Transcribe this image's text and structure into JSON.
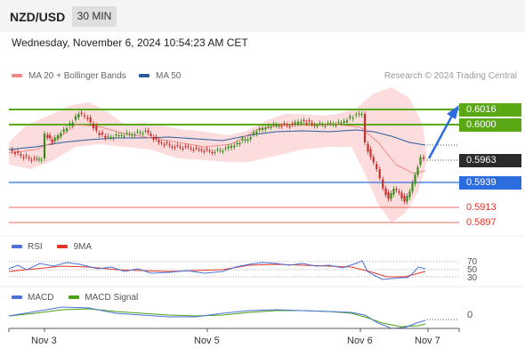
{
  "header": {
    "symbol": "NZD/USD",
    "timeframe": "30 MIN"
  },
  "datetime": "Wednesday, November 6, 2024 10:54:23 AM CET",
  "legend": {
    "ma20": "MA 20 + Bollinger Bands",
    "ma50": "MA 50",
    "credit": "Research © 2024 Trading Central"
  },
  "colors": {
    "ma20": "#f08a8a",
    "ma50": "#2a5d9c",
    "band": "#fbd6d6",
    "up": "#3a8a1c",
    "down": "#c9302c",
    "resistance": "#5aa813",
    "pivot": "#2b6cde",
    "support": "#e0362a",
    "rsi": "#4a72d8",
    "rsi_ma": "#e0362a",
    "macd": "#4a72d8",
    "macd_signal": "#4aa013"
  },
  "levels": {
    "r2": "0.6016",
    "r1": "0.6000",
    "last": "0.5963",
    "pivot": "0.5939",
    "s1": "0.5913",
    "s2": "0.5897"
  },
  "rsi": {
    "label": "RSI",
    "ma_label": "9MA",
    "levels": [
      "70",
      "50",
      "30"
    ]
  },
  "macd": {
    "label": "MACD",
    "signal_label": "MACD Signal",
    "zero": "0"
  },
  "xaxis": [
    "Nov 3",
    "Nov 5",
    "Nov 6",
    "Nov 7"
  ]
}
